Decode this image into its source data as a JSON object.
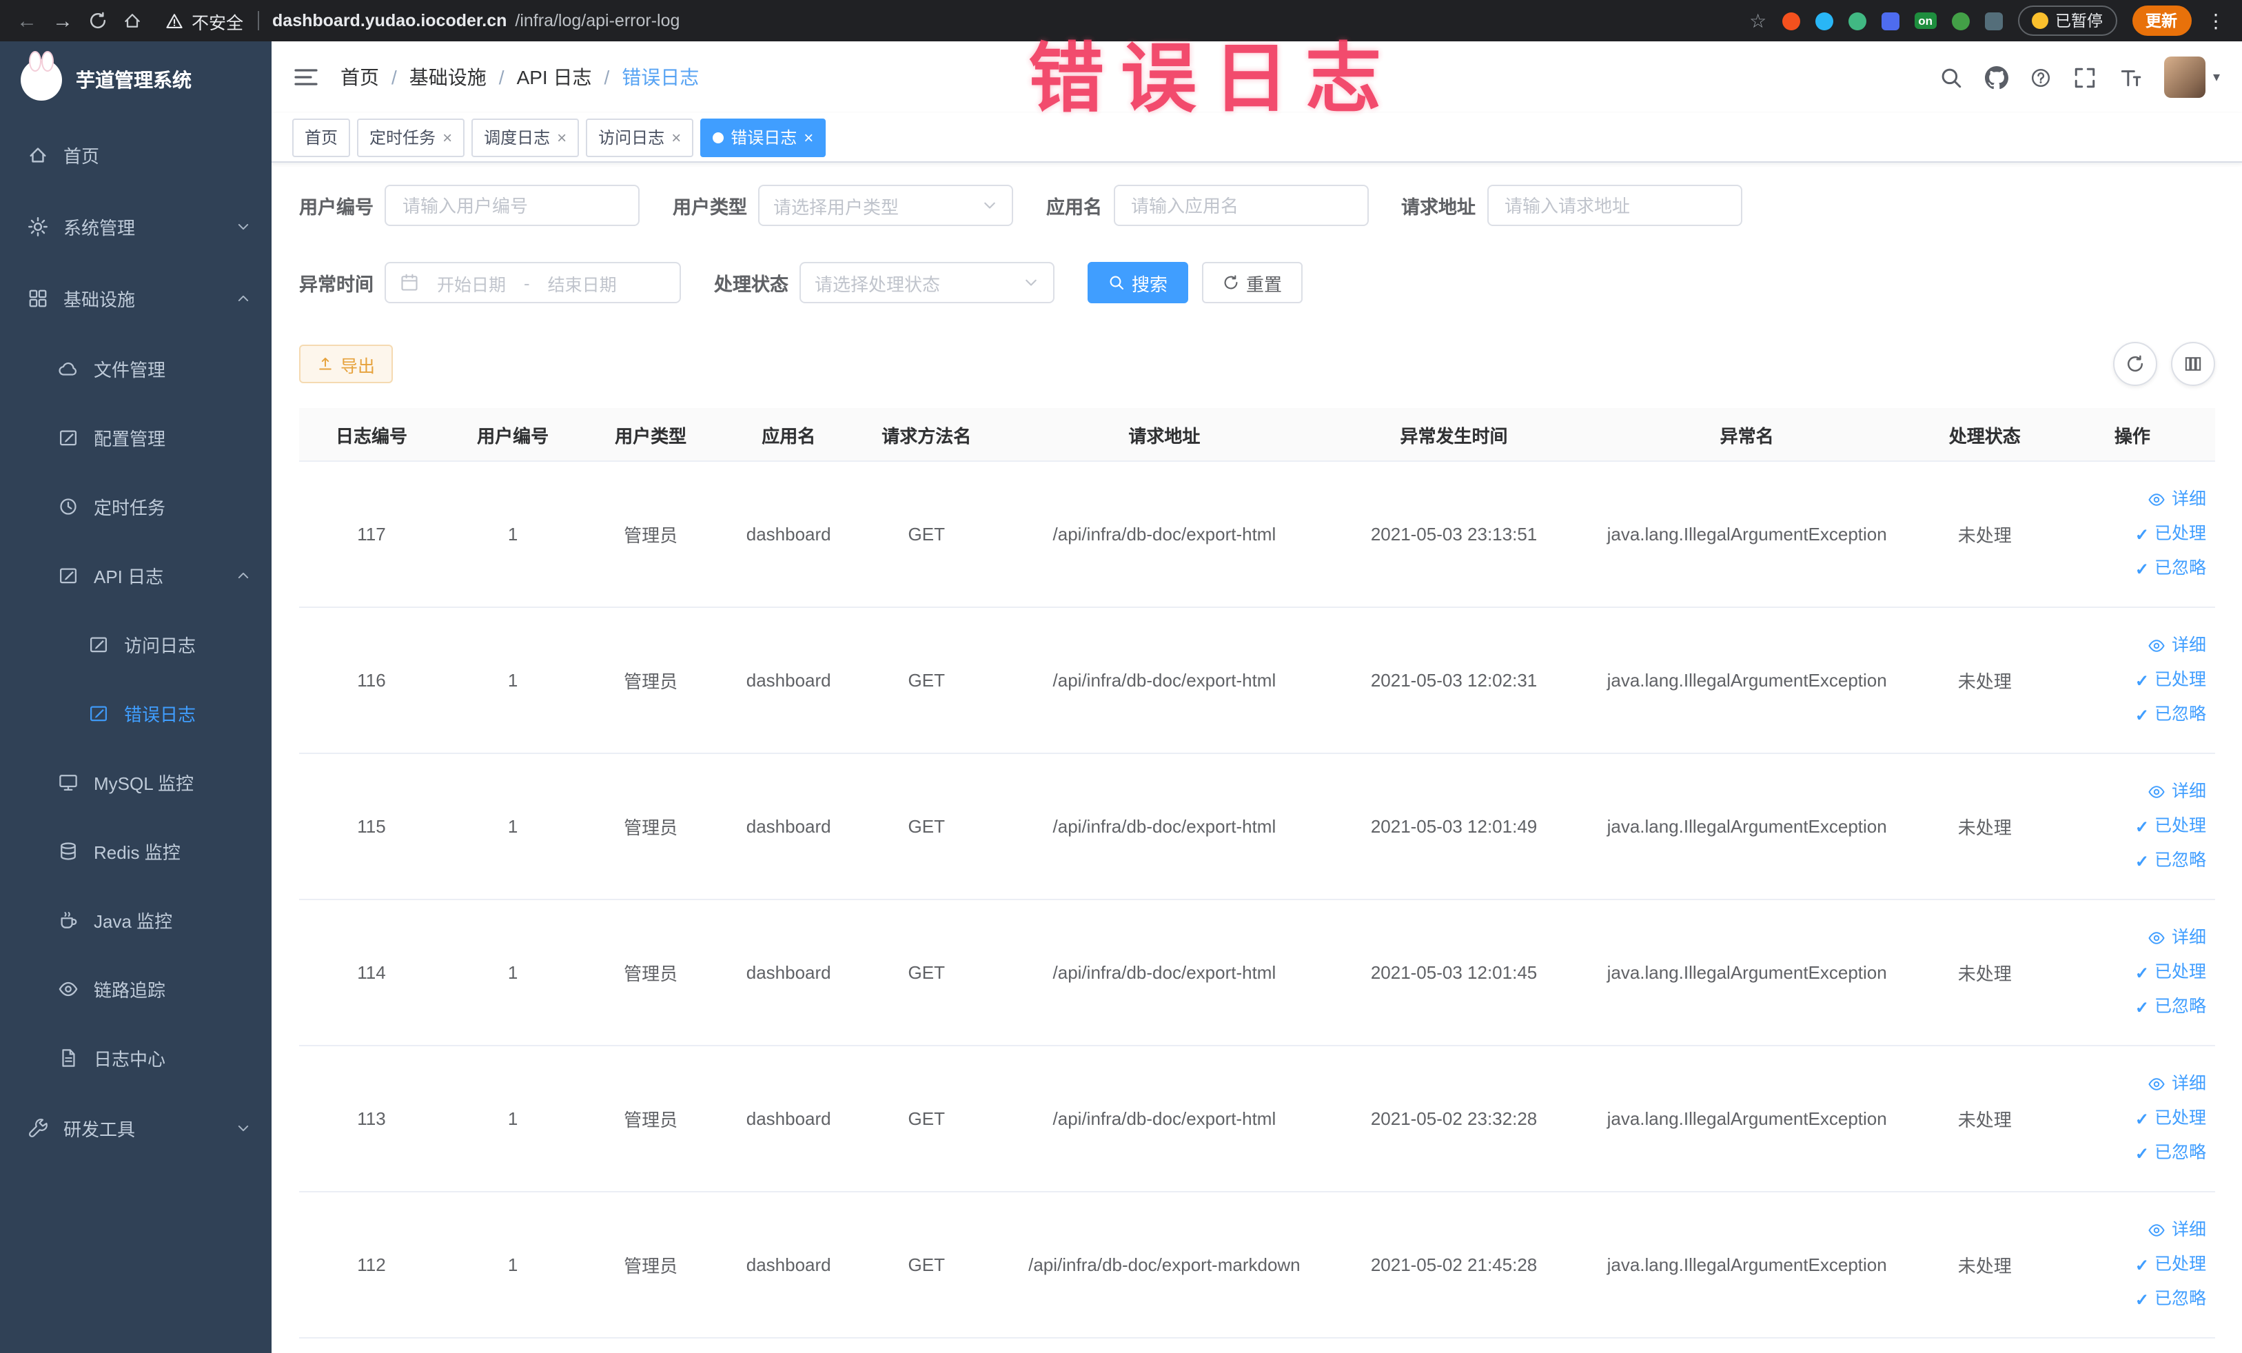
{
  "browser": {
    "security_label": "不安全",
    "url_host": "dashboard.yudao.iocoder.cn",
    "url_path": "/infra/log/api-error-log",
    "paused_badge": "已暂停",
    "update_button": "更新",
    "ext_on_label": "on"
  },
  "annotation": {
    "text": "错误日志"
  },
  "sidebar": {
    "logo_title": "芋道管理系统",
    "items": [
      {
        "label": "首页"
      },
      {
        "label": "系统管理"
      },
      {
        "label": "基础设施",
        "children": [
          {
            "label": "文件管理"
          },
          {
            "label": "配置管理"
          },
          {
            "label": "定时任务"
          },
          {
            "label": "API 日志",
            "children": [
              {
                "label": "访问日志"
              },
              {
                "label": "错误日志",
                "active": true
              }
            ]
          },
          {
            "label": "MySQL 监控"
          },
          {
            "label": "Redis 监控"
          },
          {
            "label": "Java 监控"
          },
          {
            "label": "链路追踪"
          },
          {
            "label": "日志中心"
          }
        ]
      },
      {
        "label": "研发工具"
      }
    ]
  },
  "navbar": {
    "breadcrumb": {
      "separator": "/",
      "items": [
        "首页",
        "基础设施",
        "API 日志",
        "错误日志"
      ]
    }
  },
  "tags": [
    {
      "label": "首页",
      "closable": false,
      "active": false
    },
    {
      "label": "定时任务",
      "closable": true,
      "active": false
    },
    {
      "label": "调度日志",
      "closable": true,
      "active": false
    },
    {
      "label": "访问日志",
      "closable": true,
      "active": false
    },
    {
      "label": "错误日志",
      "closable": true,
      "active": true
    }
  ],
  "filters": {
    "user_id": {
      "label": "用户编号",
      "placeholder": "请输入用户编号"
    },
    "user_type": {
      "label": "用户类型",
      "placeholder": "请选择用户类型"
    },
    "app_name": {
      "label": "应用名",
      "placeholder": "请输入应用名"
    },
    "request_url": {
      "label": "请求地址",
      "placeholder": "请输入请求地址"
    },
    "exception_time": {
      "label": "异常时间",
      "start_placeholder": "开始日期",
      "separator": "-",
      "end_placeholder": "结束日期"
    },
    "process_status": {
      "label": "处理状态",
      "placeholder": "请选择处理状态"
    },
    "search_button": "搜索",
    "reset_button": "重置"
  },
  "toolbar": {
    "export_button": "导出"
  },
  "table": {
    "columns": [
      "日志编号",
      "用户编号",
      "用户类型",
      "应用名",
      "请求方法名",
      "请求地址",
      "异常发生时间",
      "异常名",
      "处理状态",
      "操作"
    ],
    "action_labels": [
      "详细",
      "已处理",
      "已忽略"
    ],
    "rows": [
      {
        "id": "117",
        "user_id": "1",
        "user_type": "管理员",
        "app": "dashboard",
        "method": "GET",
        "url": "/api/infra/db-doc/export-html",
        "time": "2021-05-03 23:13:51",
        "exception": "java.lang.IllegalArgumentException",
        "status": "未处理"
      },
      {
        "id": "116",
        "user_id": "1",
        "user_type": "管理员",
        "app": "dashboard",
        "method": "GET",
        "url": "/api/infra/db-doc/export-html",
        "time": "2021-05-03 12:02:31",
        "exception": "java.lang.IllegalArgumentException",
        "status": "未处理"
      },
      {
        "id": "115",
        "user_id": "1",
        "user_type": "管理员",
        "app": "dashboard",
        "method": "GET",
        "url": "/api/infra/db-doc/export-html",
        "time": "2021-05-03 12:01:49",
        "exception": "java.lang.IllegalArgumentException",
        "status": "未处理"
      },
      {
        "id": "114",
        "user_id": "1",
        "user_type": "管理员",
        "app": "dashboard",
        "method": "GET",
        "url": "/api/infra/db-doc/export-html",
        "time": "2021-05-03 12:01:45",
        "exception": "java.lang.IllegalArgumentException",
        "status": "未处理"
      },
      {
        "id": "113",
        "user_id": "1",
        "user_type": "管理员",
        "app": "dashboard",
        "method": "GET",
        "url": "/api/infra/db-doc/export-html",
        "time": "2021-05-02 23:32:28",
        "exception": "java.lang.IllegalArgumentException",
        "status": "未处理"
      },
      {
        "id": "112",
        "user_id": "1",
        "user_type": "管理员",
        "app": "dashboard",
        "method": "GET",
        "url": "/api/infra/db-doc/export-markdown",
        "time": "2021-05-02 21:45:28",
        "exception": "java.lang.IllegalArgumentException",
        "status": "未处理"
      }
    ]
  },
  "icons": {
    "star": "☆",
    "kebab": "⋮",
    "close": "×",
    "check": "✓",
    "back": "←",
    "forward": "→",
    "caret": "▾"
  },
  "colors": {
    "accent": "#409eff",
    "annotation": "#f23e62",
    "warning_text": "#e6a23c",
    "warning_bg": "#fdf6ec",
    "warning_border": "#f5dab1",
    "sidebar_bg": "#304156",
    "sidebar_text": "#bfcbd9",
    "browser_bg": "#202124",
    "update_pill": "#e8710a",
    "tag_border": "#d8dce5",
    "table_border": "#ebeef5",
    "header_bg": "#fafafa",
    "text_primary": "#303133",
    "text_regular": "#606266",
    "placeholder": "#c0c4cc",
    "breadcrumb_active": "#57a3f3",
    "ext_1": "#f4511e",
    "ext_2": "#29b6f6",
    "ext_3": "#41b883",
    "ext_4": "#4e6cef",
    "ext_5": "#1e8e3e",
    "ext_6": "#43a047",
    "ext_7": "#546e7a"
  }
}
